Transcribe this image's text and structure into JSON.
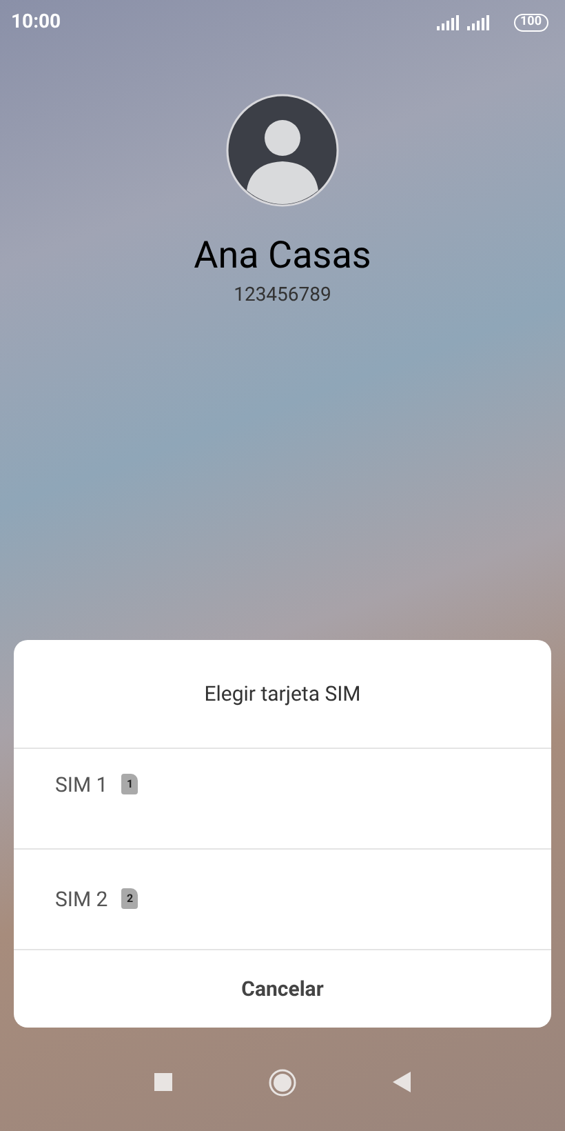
{
  "status_bar": {
    "time": "10:00",
    "battery": "100"
  },
  "contact": {
    "name": "Ana Casas",
    "number": "123456789"
  },
  "sim_dialog": {
    "title": "Elegir tarjeta SIM",
    "options": [
      {
        "label": "SIM 1",
        "badge": "1"
      },
      {
        "label": "SIM 2",
        "badge": "2"
      }
    ],
    "cancel": "Cancelar"
  }
}
